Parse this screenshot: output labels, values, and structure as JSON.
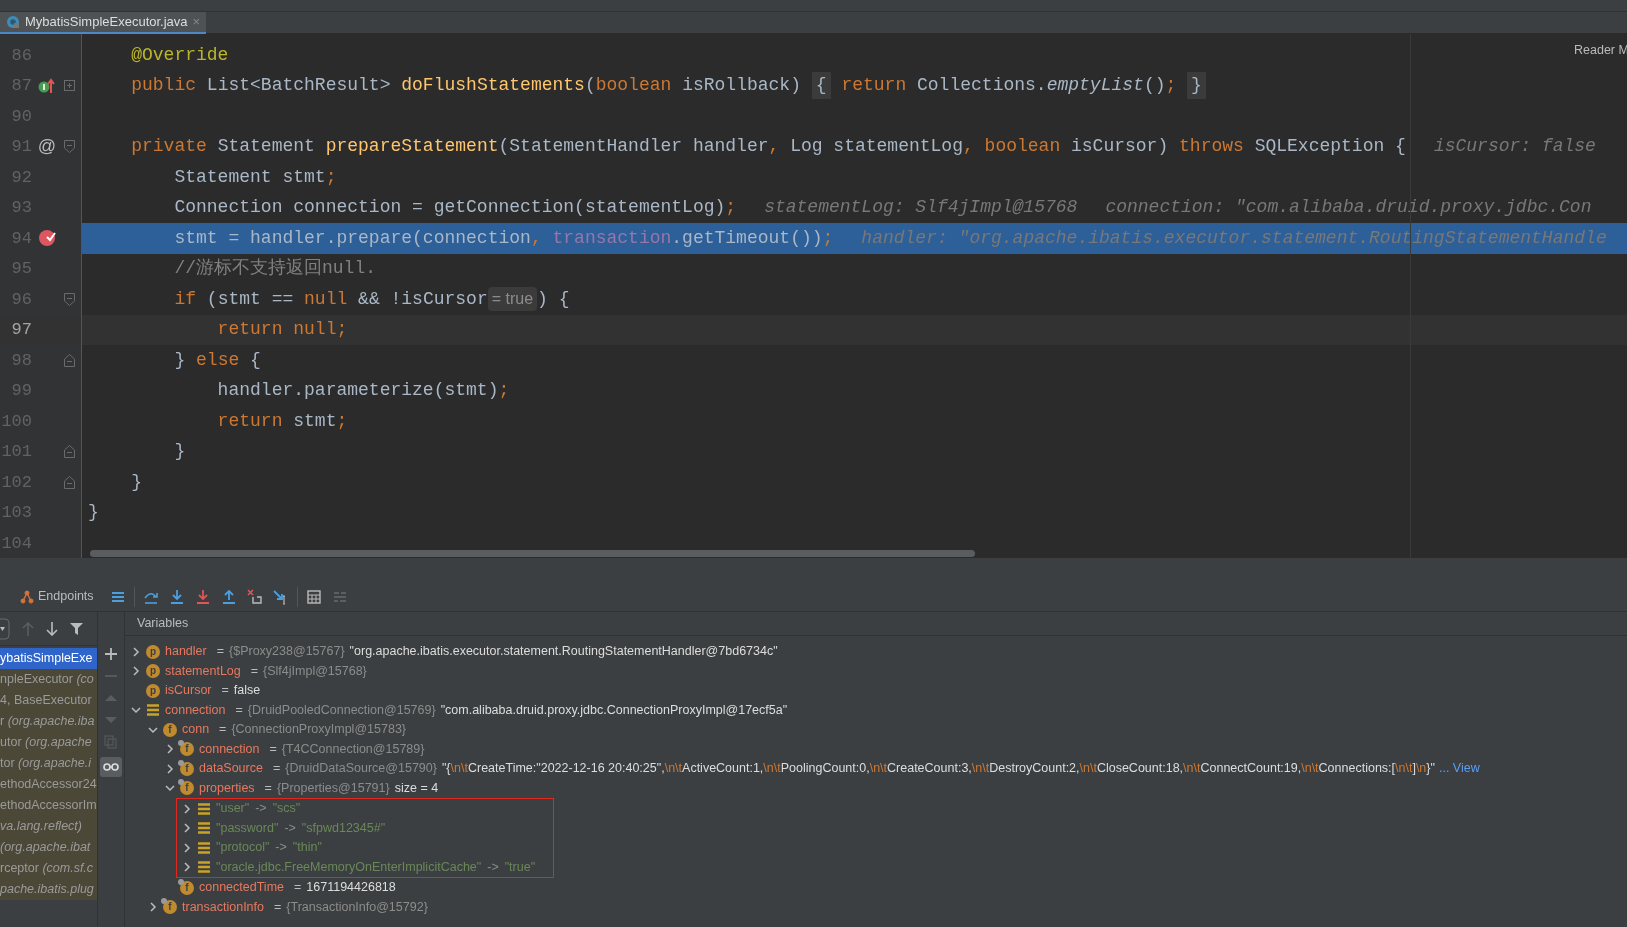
{
  "editor_tab": {
    "label": "MybatisSimpleExecutor.java",
    "close": "×",
    "selected": true
  },
  "reader_mode": "Reader M",
  "code_lines": [
    {
      "number": "86",
      "selected": false,
      "current": false,
      "tokens": [
        {
          "kind": "ann",
          "t": "    @Override"
        }
      ]
    },
    {
      "number": "87",
      "selected": false,
      "current": false,
      "gutter_icon": {
        "kind": "implements"
      },
      "fold": {
        "kind": "expand"
      },
      "tokens": [
        {
          "kind": "kw",
          "t": "    public"
        },
        {
          "kind": "plain",
          "t": " List<BatchResult> "
        },
        {
          "kind": "fn",
          "t": "doFlushStatements"
        },
        {
          "kind": "plain",
          "t": "("
        },
        {
          "kind": "kw",
          "t": "boolean"
        },
        {
          "kind": "plain",
          "t": " isRollback) "
        },
        {
          "kind": "folded",
          "t": "{"
        },
        {
          "kind": "kw",
          "t": " return"
        },
        {
          "kind": "plain",
          "t": " Collections."
        },
        {
          "kind": "italic",
          "t": "emptyList"
        },
        {
          "kind": "plain",
          "t": "()"
        },
        {
          "kind": "kw",
          "t": "; "
        },
        {
          "kind": "folded",
          "t": "}"
        }
      ]
    },
    {
      "number": "90",
      "selected": false,
      "current": false
    },
    {
      "number": "91",
      "selected": false,
      "current": false,
      "gutter_text": "@",
      "fold": {
        "kind": "collapse"
      },
      "tokens": [
        {
          "kind": "kw",
          "t": "    private"
        },
        {
          "kind": "plain",
          "t": " Statement "
        },
        {
          "kind": "fn",
          "t": "prepareStatement"
        },
        {
          "kind": "plain",
          "t": "(StatementHandler handler"
        },
        {
          "kind": "kw",
          "t": ","
        },
        {
          "kind": "plain",
          "t": " Log statementLog"
        },
        {
          "kind": "kw",
          "t": ", boolean"
        },
        {
          "kind": "plain",
          "t": " isCursor) "
        },
        {
          "kind": "kw",
          "t": "throws"
        },
        {
          "kind": "plain",
          "t": " SQLException {"
        },
        {
          "kind": "hint",
          "t": "isCursor: false"
        }
      ]
    },
    {
      "number": "92",
      "selected": false,
      "current": false,
      "tokens": [
        {
          "kind": "plain",
          "t": "        Statement stmt"
        },
        {
          "kind": "kw",
          "t": ";"
        }
      ]
    },
    {
      "number": "93",
      "selected": false,
      "current": false,
      "tokens": [
        {
          "kind": "plain",
          "t": "        Connection connection = getConnection(statementLog)"
        },
        {
          "kind": "kw",
          "t": ";"
        },
        {
          "kind": "hint",
          "t": "statementLog: Slf4jImpl@15768"
        },
        {
          "kind": "hint",
          "t": "connection: \"com.alibaba.druid.proxy.jdbc.Con"
        }
      ]
    },
    {
      "number": "94",
      "selected": true,
      "current": false,
      "gutter_icon": {
        "kind": "breakpoint"
      },
      "tokens": [
        {
          "kind": "plain",
          "t": "        stmt = handler.prepare(connection"
        },
        {
          "kind": "kw",
          "t": ","
        },
        {
          "kind": "field",
          "t": " transaction"
        },
        {
          "kind": "plain",
          "t": ".getTimeout())"
        },
        {
          "kind": "kw",
          "t": ";"
        },
        {
          "kind": "hint",
          "t": "handler: \"org.apache.ibatis.executor.statement.RoutingStatementHandle"
        }
      ]
    },
    {
      "number": "95",
      "selected": false,
      "current": false,
      "tokens": [
        {
          "kind": "comment",
          "t": "        //游标不支持返回null."
        }
      ]
    },
    {
      "number": "96",
      "selected": false,
      "current": false,
      "fold": {
        "kind": "collapse"
      },
      "tokens": [
        {
          "kind": "kw",
          "t": "        if"
        },
        {
          "kind": "plain",
          "t": " (stmt == "
        },
        {
          "kind": "kw",
          "t": "null"
        },
        {
          "kind": "plain",
          "t": " && !isCursor"
        },
        {
          "kind": "inlay",
          "t": "= true"
        },
        {
          "kind": "plain",
          "t": ") {"
        }
      ]
    },
    {
      "number": "97",
      "selected": false,
      "current": true,
      "tokens": [
        {
          "kind": "kw",
          "t": "            return null;"
        }
      ]
    },
    {
      "number": "98",
      "selected": false,
      "current": false,
      "fold": {
        "kind": "end"
      },
      "tokens": [
        {
          "kind": "plain",
          "t": "        } "
        },
        {
          "kind": "kw",
          "t": "else"
        },
        {
          "kind": "plain",
          "t": " {"
        }
      ]
    },
    {
      "number": "99",
      "selected": false,
      "current": false,
      "tokens": [
        {
          "kind": "plain",
          "t": "            handler.parameterize(stmt)"
        },
        {
          "kind": "kw",
          "t": ";"
        }
      ]
    },
    {
      "number": "100",
      "selected": false,
      "current": false,
      "tokens": [
        {
          "kind": "kw",
          "t": "            return"
        },
        {
          "kind": "plain",
          "t": " stmt"
        },
        {
          "kind": "kw",
          "t": ";"
        }
      ]
    },
    {
      "number": "101",
      "selected": false,
      "current": false,
      "fold": {
        "kind": "end"
      },
      "tokens": [
        {
          "kind": "plain",
          "t": "        }"
        }
      ]
    },
    {
      "number": "102",
      "selected": false,
      "current": false,
      "fold": {
        "kind": "end"
      },
      "tokens": [
        {
          "kind": "plain",
          "t": "    }"
        }
      ]
    },
    {
      "number": "103",
      "selected": false,
      "current": false,
      "tokens": [
        {
          "kind": "plain",
          "t": "}"
        }
      ]
    },
    {
      "number": "104",
      "selected": false,
      "current": false
    }
  ],
  "debug_toolbar": {
    "endpoints": "Endpoints"
  },
  "frames": [
    {
      "text": "ybatisSimpleExe",
      "selected": true
    },
    {
      "text": "npleExecutor *(co*",
      "selected": false
    },
    {
      "text": "4, BaseExecutor",
      "selected": false
    },
    {
      "text": "r *(org.apache.iba*",
      "selected": false
    },
    {
      "text": "utor *(org.apache*",
      "selected": false
    },
    {
      "text": "tor *(org.apache.i*",
      "selected": false
    },
    {
      "text": "ethodAccessor24",
      "selected": false
    },
    {
      "text": "ethodAccessorIm",
      "selected": false
    },
    {
      "text": "*va.lang.reflect)*",
      "selected": false
    },
    {
      "text": "*(org.apache.ibat*",
      "selected": false
    },
    {
      "text": "rceptor *(com.sf.c*",
      "selected": false
    },
    {
      "text": "*pache.ibatis.plug*",
      "selected": false
    }
  ],
  "variables": {
    "title": "Variables",
    "items": [
      {
        "kind": "param",
        "badge": "p",
        "name": "handler",
        "expanded": false,
        "value": [
          {
            "kind": "eq",
            "t": "="
          },
          {
            "kind": "type",
            "t": "{$Proxy238@15767}"
          },
          {
            "kind": "str",
            "t": "\"org.apache.ibatis.executor.statement.RoutingStatementHandler@7bd6734c\""
          }
        ]
      },
      {
        "kind": "param",
        "badge": "p",
        "name": "statementLog",
        "expanded": false,
        "value": [
          {
            "kind": "eq",
            "t": "="
          },
          {
            "kind": "type",
            "t": "{Slf4jImpl@15768}"
          }
        ]
      },
      {
        "kind": "param",
        "badge": "p",
        "name": "isCursor",
        "value": [
          {
            "kind": "eq",
            "t": "="
          },
          {
            "kind": "str",
            "t": "false"
          }
        ]
      },
      {
        "kind": "object",
        "name": "connection",
        "expanded": true,
        "value": [
          {
            "kind": "eq",
            "t": "="
          },
          {
            "kind": "type",
            "t": "{DruidPooledConnection@15769}"
          },
          {
            "kind": "str",
            "t": "\"com.alibaba.druid.proxy.jdbc.ConnectionProxyImpl@17ecf5a\""
          }
        ],
        "children": [
          {
            "kind": "field",
            "badge": "f",
            "locked": false,
            "name": "conn",
            "expanded": true,
            "value": [
              {
                "kind": "eq",
                "t": "="
              },
              {
                "kind": "type",
                "t": "{ConnectionProxyImpl@15783}"
              }
            ],
            "children": [
              {
                "kind": "field",
                "badge": "f",
                "locked": true,
                "name": "connection",
                "expanded": false,
                "value": [
                  {
                    "kind": "eq",
                    "t": "="
                  },
                  {
                    "kind": "type",
                    "t": "{T4CConnection@15789}"
                  }
                ]
              },
              {
                "kind": "field",
                "badge": "f",
                "locked": true,
                "name": "dataSource",
                "expanded": false,
                "value": [
                  {
                    "kind": "eq",
                    "t": "="
                  },
                  {
                    "kind": "type",
                    "t": "{DruidDataSource@15790}"
                  },
                  {
                    "kind": "str",
                    "t": "\"{"
                  },
                  {
                    "kind": "esc",
                    "t": "\\n\\t"
                  },
                  {
                    "kind": "str",
                    "t": "CreateTime:\"2022-12-16 20:40:25\","
                  },
                  {
                    "kind": "esc",
                    "t": "\\n\\t"
                  },
                  {
                    "kind": "str",
                    "t": "ActiveCount:1,"
                  },
                  {
                    "kind": "esc",
                    "t": "\\n\\t"
                  },
                  {
                    "kind": "str",
                    "t": "PoolingCount:0,"
                  },
                  {
                    "kind": "esc",
                    "t": "\\n\\t"
                  },
                  {
                    "kind": "str",
                    "t": "CreateCount:3,"
                  },
                  {
                    "kind": "esc",
                    "t": "\\n\\t"
                  },
                  {
                    "kind": "str",
                    "t": "DestroyCount:2,"
                  },
                  {
                    "kind": "esc",
                    "t": "\\n\\t"
                  },
                  {
                    "kind": "str",
                    "t": "CloseCount:18,"
                  },
                  {
                    "kind": "esc",
                    "t": "\\n\\t"
                  },
                  {
                    "kind": "str",
                    "t": "ConnectCount:19,"
                  },
                  {
                    "kind": "esc",
                    "t": "\\n\\t"
                  },
                  {
                    "kind": "str",
                    "t": "Connections:["
                  },
                  {
                    "kind": "esc",
                    "t": "\\n\\t"
                  },
                  {
                    "kind": "str",
                    "t": "]"
                  },
                  {
                    "kind": "esc",
                    "t": "\\n"
                  },
                  {
                    "kind": "str",
                    "t": "}\""
                  },
                  {
                    "kind": "link",
                    "t": "... View"
                  }
                ]
              },
              {
                "kind": "field",
                "badge": "f",
                "locked": true,
                "name": "properties",
                "expanded": true,
                "highlight_children": true,
                "value": [
                  {
                    "kind": "eq",
                    "t": "="
                  },
                  {
                    "kind": "type",
                    "t": "{Properties@15791}"
                  },
                  {
                    "kind": "str",
                    "t": "size = 4"
                  }
                ],
                "children": [
                  {
                    "kind": "entry",
                    "expanded": false,
                    "value": [
                      {
                        "kind": "key",
                        "t": "\"user\""
                      },
                      {
                        "kind": "arrow",
                        "t": "->"
                      },
                      {
                        "kind": "key",
                        "t": "\"scs\""
                      }
                    ]
                  },
                  {
                    "kind": "entry",
                    "expanded": false,
                    "value": [
                      {
                        "kind": "key",
                        "t": "\"password\""
                      },
                      {
                        "kind": "arrow",
                        "t": "->"
                      },
                      {
                        "kind": "key",
                        "t": "\"sfpwd12345#\""
                      }
                    ]
                  },
                  {
                    "kind": "entry",
                    "expanded": false,
                    "value": [
                      {
                        "kind": "key",
                        "t": "\"protocol\""
                      },
                      {
                        "kind": "arrow",
                        "t": "->"
                      },
                      {
                        "kind": "key",
                        "t": "\"thin\""
                      }
                    ]
                  },
                  {
                    "kind": "entry",
                    "expanded": false,
                    "value": [
                      {
                        "kind": "key",
                        "t": "\"oracle.jdbc.FreeMemoryOnEnterImplicitCache\""
                      },
                      {
                        "kind": "arrow",
                        "t": "->"
                      },
                      {
                        "kind": "key",
                        "t": "\"true\""
                      }
                    ]
                  }
                ]
              },
              {
                "kind": "field",
                "badge": "f",
                "locked": true,
                "name": "connectedTime",
                "value": [
                  {
                    "kind": "eq",
                    "t": "="
                  },
                  {
                    "kind": "str",
                    "t": "1671194426818"
                  }
                ]
              }
            ]
          },
          {
            "kind": "field",
            "badge": "f",
            "locked": true,
            "name": "transactionInfo",
            "expanded": false,
            "value": [
              {
                "kind": "eq",
                "t": "="
              },
              {
                "kind": "type",
                "t": "{TransactionInfo@15792}"
              }
            ]
          }
        ]
      }
    ]
  }
}
